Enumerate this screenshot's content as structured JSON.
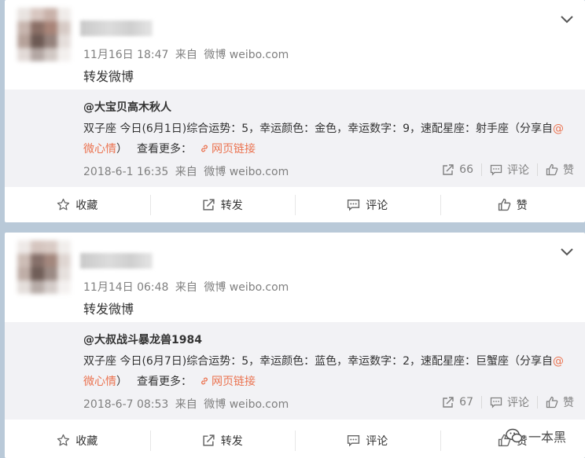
{
  "posts": [
    {
      "timestamp": "11月16日 18:47",
      "source_prefix": "来自",
      "source": "微博 weibo.com",
      "text": "转发微博",
      "forward": {
        "author": "@大宝贝高木秋人",
        "body_prefix": "双子座 今日(6月1日)综合运势：5，幸运颜色：金色，幸运数字：9，速配星座：射手座（分享自",
        "mention": "@微心情",
        "body_suffix": "）",
        "see_more": "查看更多：",
        "web_link": "网页链接",
        "date": "2018-6-1 16:35",
        "source_prefix": "来自",
        "source": "微博 weibo.com",
        "repost_count": "66",
        "comment_label": "评论",
        "like_label": "赞"
      }
    },
    {
      "timestamp": "11月14日 06:48",
      "source_prefix": "来自",
      "source": "微博 weibo.com",
      "text": "转发微博",
      "forward": {
        "author": "@大叔战斗暴龙兽1984",
        "body_prefix": "双子座 今日(6月7日)综合运势：5，幸运颜色：蓝色，幸运数字：2，速配星座：巨蟹座（分享自",
        "mention": "@微心情",
        "body_suffix": "）",
        "see_more": "查看更多：",
        "web_link": "网页链接",
        "date": "2018-6-7 08:53",
        "source_prefix": "来自",
        "source": "微博 weibo.com",
        "repost_count": "67",
        "comment_label": "评论",
        "like_label": "赞"
      }
    }
  ],
  "actions": {
    "favorite": "收藏",
    "repost": "转发",
    "comment": "评论",
    "like": "赞"
  },
  "watermark": "一本黑",
  "colors": {
    "page_bg": "#b9c9d8",
    "card_bg": "#ffffff",
    "forward_bg": "#f2f2f5",
    "link": "#eb7350",
    "meta": "#808080"
  }
}
